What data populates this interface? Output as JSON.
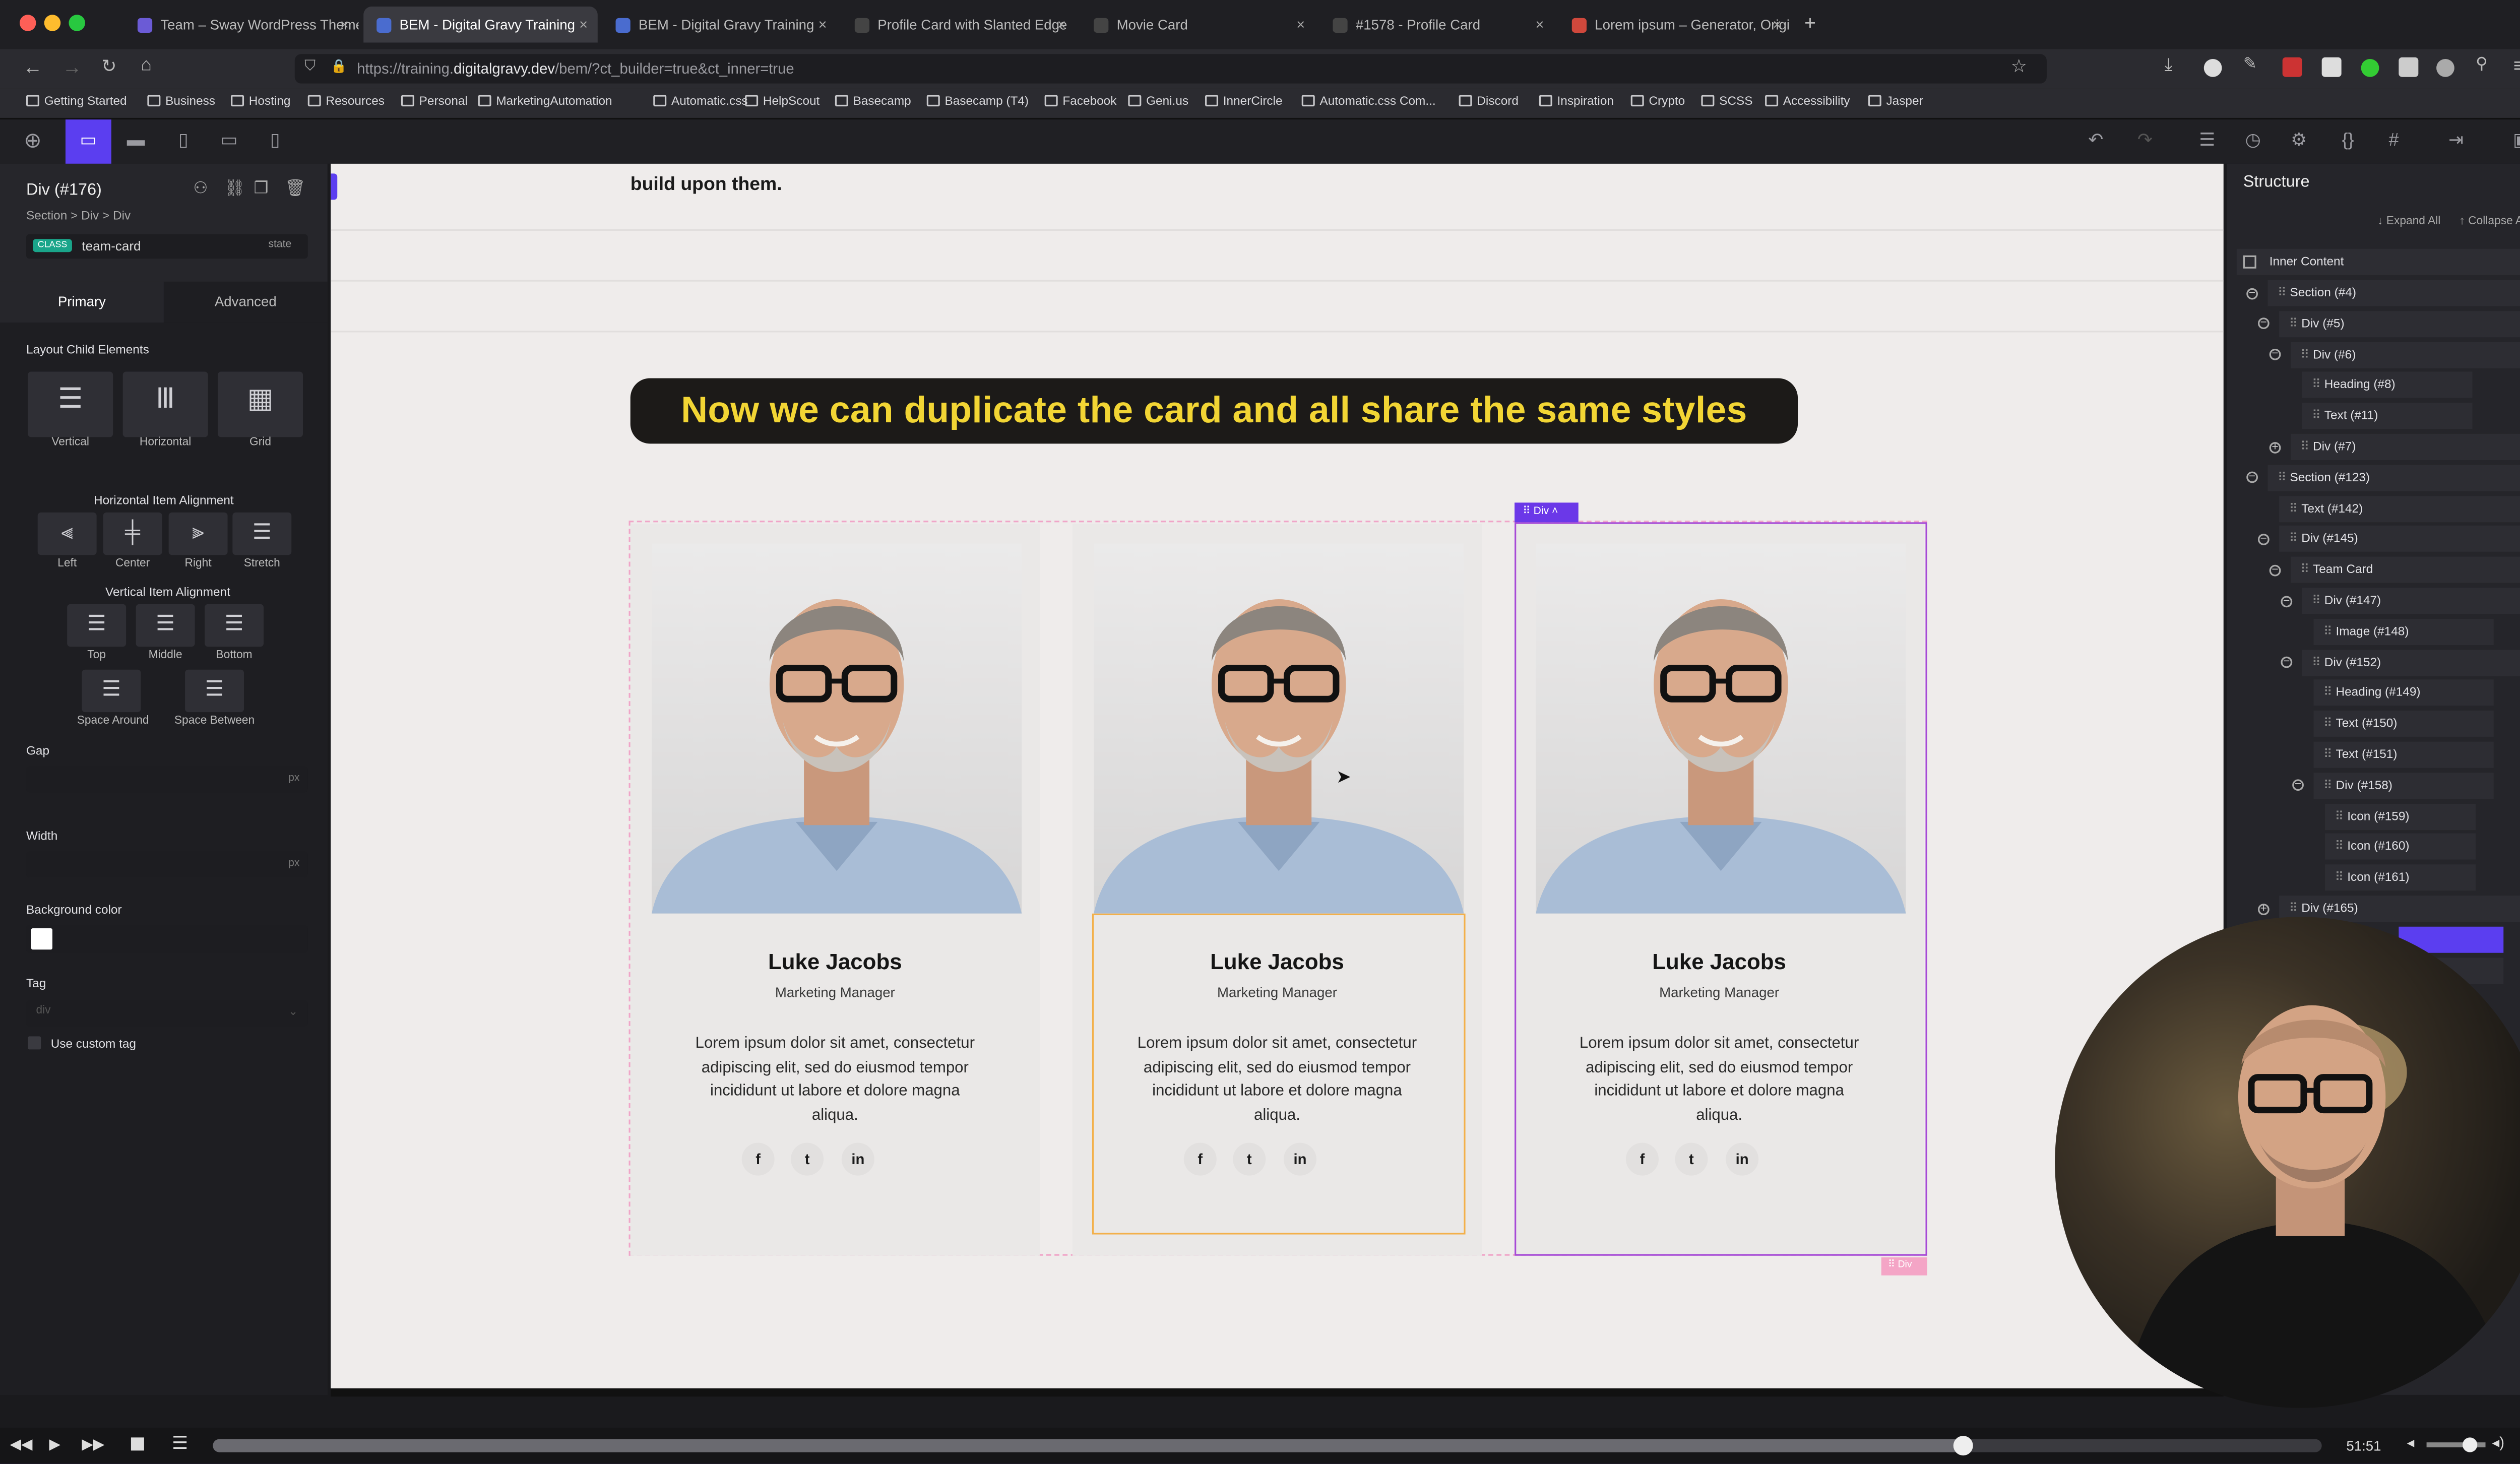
{
  "browser": {
    "tabs": [
      {
        "label": "Team – Sway WordPress Theme",
        "color": "#6b5bd6"
      },
      {
        "label": "BEM - Digital Gravy Training",
        "color": "#4a6ccf"
      },
      {
        "label": "BEM - Digital Gravy Training",
        "color": "#4a6ccf"
      },
      {
        "label": "Profile Card with Slanted Edge",
        "color": "#444"
      },
      {
        "label": "Movie Card",
        "color": "#444"
      },
      {
        "label": "#1578 - Profile Card",
        "color": "#444"
      },
      {
        "label": "Lorem ipsum – Generator, Origi",
        "color": "#d0483c"
      }
    ],
    "url_prefix": "https://training.",
    "url_domain": "digitalgravy.dev",
    "url_path": "/bem/?ct_builder=true&ct_inner=true",
    "bookmarks": [
      "Getting Started",
      "Business",
      "Hosting",
      "Resources",
      "Personal",
      "MarketingAutomation",
      "Automatic.css",
      "HelpScout",
      "Basecamp",
      "Basecamp (T4)",
      "Facebook",
      "Geni.us",
      "InnerCircle",
      "Automatic.css Com...",
      "Discord",
      "Inspiration",
      "Crypto",
      "SCSS",
      "Accessibility",
      "Jasper"
    ]
  },
  "editor": {
    "element_title": "Div (#176)",
    "breadcrumb": "Section > Div > Div",
    "class_tag": "CLASS",
    "class_name": "team-card",
    "state_label": "state",
    "tabs": {
      "primary": "Primary",
      "advanced": "Advanced"
    },
    "layout_label": "Layout Child Elements",
    "layout_options": [
      "Vertical",
      "Horizontal",
      "Grid"
    ],
    "h_align_label": "Horizontal Item Alignment",
    "h_align_options": [
      "Left",
      "Center",
      "Right",
      "Stretch"
    ],
    "v_align_label": "Vertical Item Alignment",
    "v_align_options": [
      "Top",
      "Middle",
      "Bottom"
    ],
    "v_align_extra": [
      "Space Around",
      "Space Between"
    ],
    "gap_label": "Gap",
    "width_label": "Width",
    "unit": "px",
    "bg_label": "Background color",
    "tag_label": "Tag",
    "tag_value": "div",
    "custom_tag_label": "Use custom tag"
  },
  "canvas": {
    "intro_text": "build upon them.",
    "caption": "Now we can duplicate the card and all share the same styles",
    "selection_badge": "Div",
    "hover_badge": "Div",
    "cards": [
      {
        "name": "Luke Jacobs",
        "role": "Marketing Manager",
        "bio": "Lorem ipsum dolor sit amet, consectetur adipiscing elit, sed do eiusmod tempor incididunt ut labore et dolore magna aliqua."
      },
      {
        "name": "Luke Jacobs",
        "role": "Marketing Manager",
        "bio": "Lorem ipsum dolor sit amet, consectetur adipiscing elit, sed do eiusmod tempor incididunt ut labore et dolore magna aliqua."
      },
      {
        "name": "Luke Jacobs",
        "role": "Marketing Manager",
        "bio": "Lorem ipsum dolor sit amet, consectetur adipiscing elit, sed do eiusmod tempor incididunt ut labore et dolore magna aliqua."
      }
    ],
    "social": [
      "f",
      "t",
      "in"
    ]
  },
  "structure": {
    "title": "Structure",
    "expand_all": "↓ Expand All",
    "collapse_all": "↑ Collapse All",
    "root": "Inner Content",
    "items": [
      {
        "label": "Section (#4)",
        "toggle": "−"
      },
      {
        "label": "Div (#5)",
        "toggle": "−"
      },
      {
        "label": "Div (#6)",
        "toggle": "−"
      },
      {
        "label": "Heading (#8)",
        "toggle": ""
      },
      {
        "label": "Text (#11)",
        "toggle": ""
      },
      {
        "label": "Div (#7)",
        "toggle": "+"
      },
      {
        "label": "Section (#123)",
        "toggle": "−"
      },
      {
        "label": "Text (#142)",
        "toggle": ""
      },
      {
        "label": "Div (#145)",
        "toggle": "−"
      },
      {
        "label": "Team Card",
        "toggle": "−"
      },
      {
        "label": "Div (#147)",
        "toggle": "−"
      },
      {
        "label": "Image (#148)",
        "toggle": ""
      },
      {
        "label": "Div (#152)",
        "toggle": "−"
      },
      {
        "label": "Heading (#149)",
        "toggle": ""
      },
      {
        "label": "Text (#150)",
        "toggle": ""
      },
      {
        "label": "Text (#151)",
        "toggle": ""
      },
      {
        "label": "Div (#158)",
        "toggle": "−"
      },
      {
        "label": "Icon (#159)",
        "toggle": ""
      },
      {
        "label": "Icon (#160)",
        "toggle": ""
      },
      {
        "label": "Icon (#161)",
        "toggle": ""
      },
      {
        "label": "Div (#165)",
        "toggle": "+"
      }
    ]
  },
  "player": {
    "time": "51:51",
    "progress": 0.83
  },
  "colors": {
    "accent": "#5b3ef0",
    "caption_text": "#f2d534",
    "class_tag": "#1aa58a",
    "selection": "#a64ad6"
  }
}
